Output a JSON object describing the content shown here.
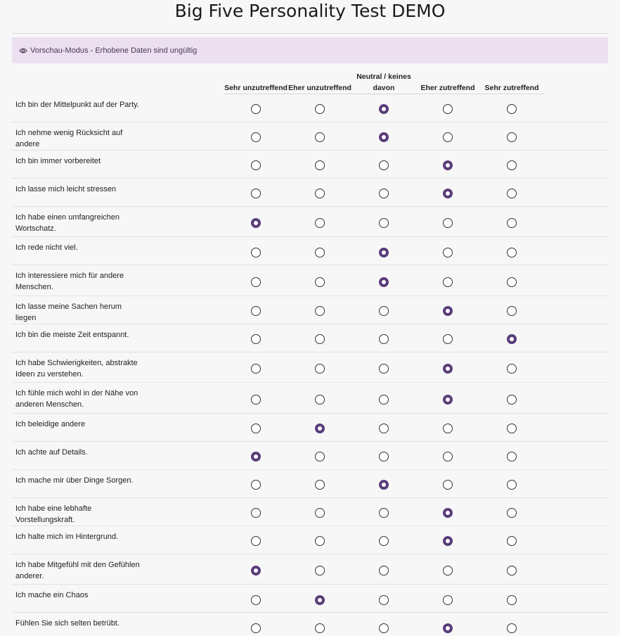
{
  "page": {
    "title": "Big Five Personality Test DEMO",
    "preview_banner": "Vorschau-Modus - Erhobene Daten sind ungültig",
    "accent_color": "#5a3d7a",
    "banner_color": "#ebdff0"
  },
  "scale": [
    "Sehr unzutreffend",
    "Eher unzutreffend",
    "Neutral / keines davon",
    "Eher zutreffend",
    "Sehr zutreffend"
  ],
  "questions": [
    {
      "text": "Ich bin der Mittelpunkt auf der Party.",
      "selected": 2
    },
    {
      "text": "Ich nehme wenig Rücksicht auf andere",
      "selected": 2
    },
    {
      "text": "Ich bin immer vorbereitet",
      "selected": 3
    },
    {
      "text": "Ich lasse mich leicht stressen",
      "selected": 3
    },
    {
      "text": "Ich habe einen umfangreichen Wortschatz.",
      "selected": 0
    },
    {
      "text": "Ich rede nicht viel.",
      "selected": 2
    },
    {
      "text": "Ich interessiere mich für andere Menschen.",
      "selected": 2
    },
    {
      "text": "Ich lasse meine Sachen herum liegen",
      "selected": 3
    },
    {
      "text": "Ich bin die meiste Zeit entspannt.",
      "selected": 4
    },
    {
      "text": "Ich habe Schwierigkeiten, abstrakte Ideen zu verstehen.",
      "selected": 3
    },
    {
      "text": "Ich fühle mich wohl in der Nähe von anderen Menschen.",
      "selected": 3
    },
    {
      "text": "Ich beleidige andere",
      "selected": 1
    },
    {
      "text": "Ich achte auf Details.",
      "selected": 0
    },
    {
      "text": "Ich mache mir über Dinge Sorgen.",
      "selected": 2
    },
    {
      "text": "Ich habe eine lebhafte Vorstellungskraft.",
      "selected": 3
    },
    {
      "text": "Ich halte mich im Hintergrund.",
      "selected": 3
    },
    {
      "text": "Ich habe Mitgefühl mit den Gefühlen anderer.",
      "selected": 0
    },
    {
      "text": "Ich mache ein Chaos",
      "selected": 1
    },
    {
      "text": "Fühlen Sie sich selten betrübt.",
      "selected": 3
    }
  ]
}
